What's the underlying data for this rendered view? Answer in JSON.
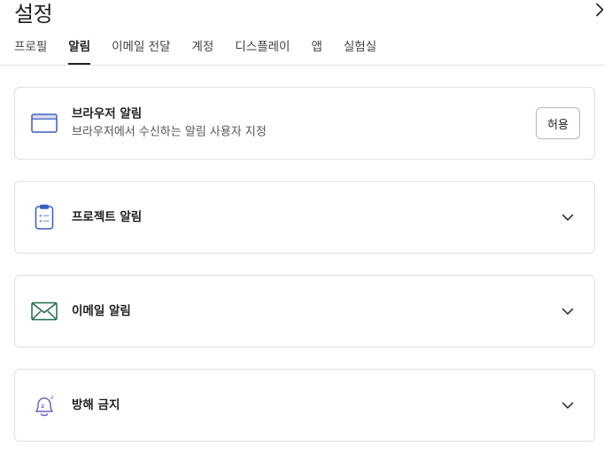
{
  "header": {
    "title": "설정"
  },
  "tabs": [
    {
      "label": "프로필"
    },
    {
      "label": "알림"
    },
    {
      "label": "이메일 전달"
    },
    {
      "label": "계정"
    },
    {
      "label": "디스플레이"
    },
    {
      "label": "앱"
    },
    {
      "label": "실험실"
    }
  ],
  "active_tab": "알림",
  "sections": {
    "browser": {
      "label": "브라우저 알림",
      "description": "브라우저에서 수신하는 알림 사용자 지정",
      "button": "허용",
      "icon": "browser-window-icon"
    },
    "project": {
      "label": "프로젝트 알림",
      "icon": "clipboard-icon"
    },
    "email": {
      "label": "이메일 알림",
      "icon": "envelope-icon"
    },
    "dnd": {
      "label": "방해 금지",
      "icon": "bell-snooze-icon"
    }
  },
  "colors": {
    "accent_blue": "#3a5bbf",
    "email_green": "#1f6b4a",
    "bell_purple": "#6b63c9"
  }
}
